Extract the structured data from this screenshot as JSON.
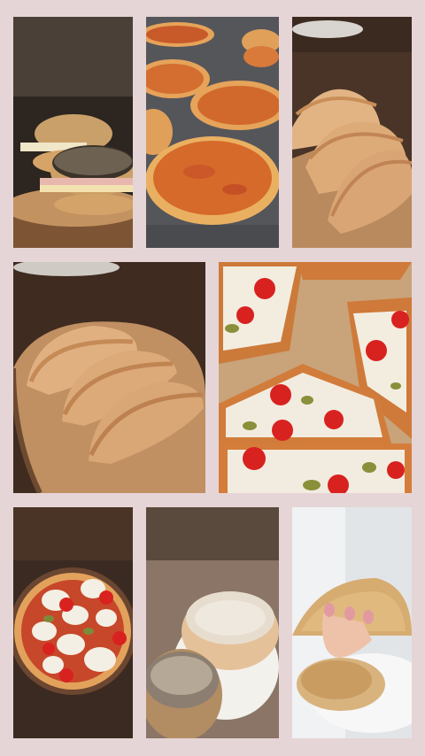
{
  "collage": {
    "background": "#e6d5d6",
    "photos": [
      {
        "subject": "seeded-bread-rolls-with-ham-and-cheese"
      },
      {
        "subject": "mini-pizzas-on-cooling-rack"
      },
      {
        "subject": "empanadas-on-wooden-board"
      },
      {
        "subject": "empanadas-on-wooden-board"
      },
      {
        "subject": "pizza-slices-with-mozzarella-tomatoes-olives"
      },
      {
        "subject": "pizza-margherita-on-wooden-plate"
      },
      {
        "subject": "seeded-bread-rolls-on-plate"
      },
      {
        "subject": "tortillas-held-in-hand"
      }
    ]
  },
  "palette": {
    "wood_dark": "#3a2a20",
    "wood_light": "#b07a4e",
    "dough": "#e0b27a",
    "sauce": "#c8562a",
    "mozzarella": "#f4efe4",
    "tomato": "#d8221f",
    "olive": "#7d8a3a"
  }
}
